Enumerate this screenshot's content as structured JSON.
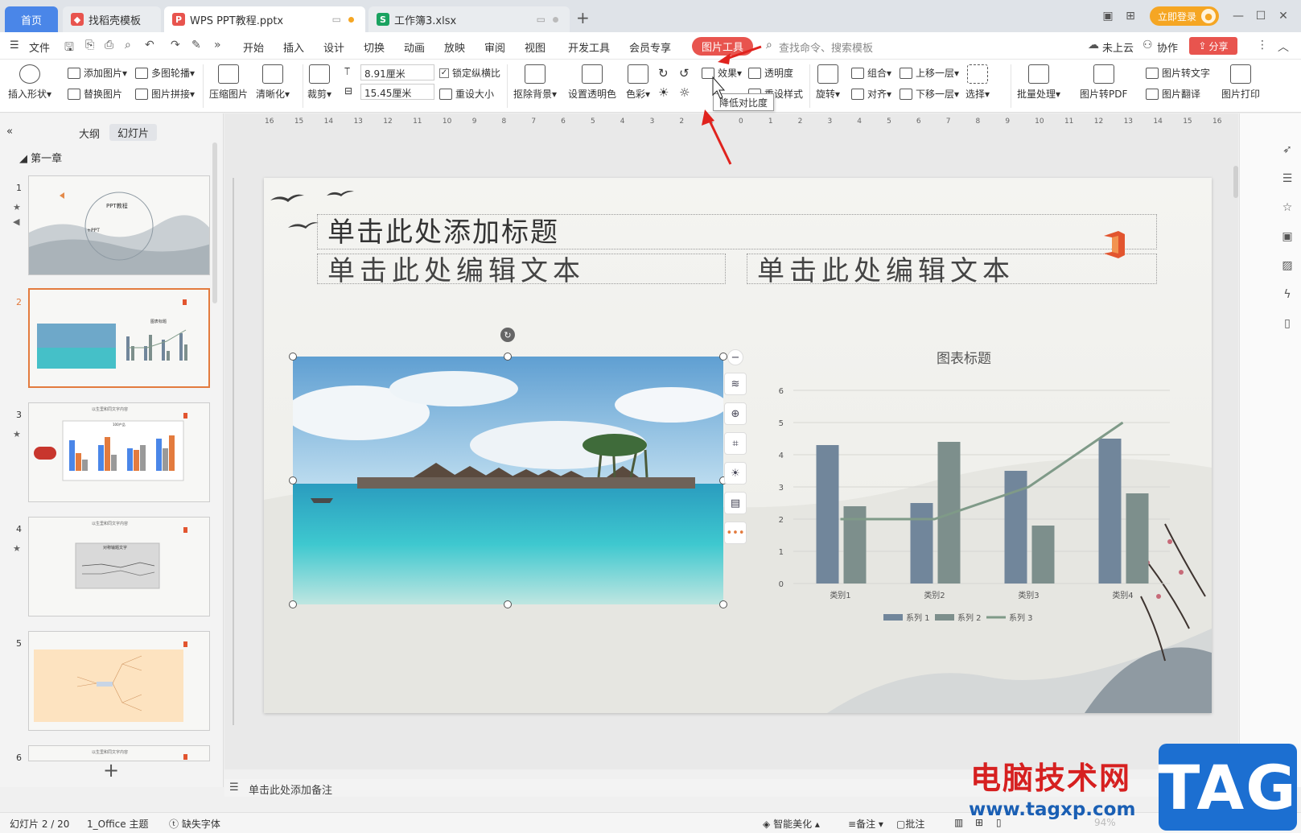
{
  "tabs": {
    "home": "首页",
    "daoke": "找稻壳模板",
    "ppt": "WPS PPT教程.pptx",
    "xls": "工作簿3.xlsx"
  },
  "window": {
    "login": "立即登录"
  },
  "menu": {
    "file": "文件",
    "items": [
      "开始",
      "插入",
      "设计",
      "切换",
      "动画",
      "放映",
      "审阅",
      "视图",
      "开发工具",
      "会员专享"
    ],
    "active": "图片工具",
    "search": "查找命令、搜索模板",
    "cloud": "未上云",
    "collab": "协作",
    "share": "分享"
  },
  "ribbon": {
    "insert_shape": "插入形状",
    "add_image": "添加图片",
    "replace_image": "替换图片",
    "multi_outline": "多图轮播",
    "image_stitch": "图片拼接",
    "compress": "压缩图片",
    "sharpen": "清晰化",
    "crop": "裁剪",
    "width": "8.91厘米",
    "height": "15.45厘米",
    "lock_ratio": "锁定纵横比",
    "reset_size": "重设大小",
    "remove_bg": "抠除背景",
    "set_transparent": "设置透明色",
    "color": "色彩",
    "effects": "效果",
    "transparency": "透明度",
    "reset_style": "重设样式",
    "rotate": "旋转",
    "group": "组合",
    "align": "对齐",
    "bring_forward": "上移一层",
    "send_backward": "下移一层",
    "select": "选择",
    "batch": "批量处理",
    "to_pdf": "图片转PDF",
    "to_text": "图片转文字",
    "translate": "图片翻译",
    "print": "图片打印",
    "tooltip": "降低对比度"
  },
  "left_panel": {
    "tab_outline": "大纲",
    "tab_slides": "幻灯片",
    "chapter": "第一章",
    "slides": [
      "1",
      "2",
      "3",
      "4",
      "5",
      "6"
    ],
    "thumb1_title": "PPT教程",
    "thumb1_sub": "+PPT",
    "thumb2_title": "图表标题",
    "thumb3_heading": "以生里和同文字内容",
    "thumb3_chart": "100产品",
    "thumb4_heading": "以生里和同文字内容",
    "thumb4_chart": "对称输题文字",
    "thumb6_heading": "以生里和同文字内容"
  },
  "slide": {
    "title": "单击此处添加标题",
    "text_left": "单击此处编辑文本",
    "text_right": "单击此处编辑文本"
  },
  "chart_data": {
    "type": "bar",
    "title": "图表标题",
    "categories": [
      "类别1",
      "类别2",
      "类别3",
      "类别4"
    ],
    "series": [
      {
        "name": "系列 1",
        "values": [
          4.3,
          2.5,
          3.5,
          4.5
        ],
        "color": "#71869b"
      },
      {
        "name": "系列 2",
        "values": [
          2.4,
          4.4,
          1.8,
          2.8
        ],
        "color": "#7d8f8c"
      },
      {
        "name": "系列 3",
        "values": [
          2,
          2,
          3,
          5
        ],
        "color": "#7f9a88",
        "kind": "line"
      }
    ],
    "ylim": [
      0,
      6
    ],
    "yticks": [
      "0",
      "1",
      "2",
      "3",
      "4",
      "5",
      "6"
    ],
    "legend": "bottom",
    "grid": true
  },
  "ruler": [
    "16",
    "15",
    "14",
    "13",
    "12",
    "11",
    "10",
    "9",
    "8",
    "7",
    "6",
    "5",
    "4",
    "3",
    "2",
    "1",
    "0",
    "1",
    "2",
    "3",
    "4",
    "5",
    "6",
    "7",
    "8",
    "9",
    "10",
    "11",
    "12",
    "13",
    "14",
    "15",
    "16"
  ],
  "notes": "单击此处添加备注",
  "status": {
    "slide_pos": "幻灯片 2 / 20",
    "theme": "1_Office 主题",
    "missing_font": "缺失字体",
    "smart": "智能美化",
    "notes_btn": "备注",
    "comment": "批注",
    "zoom": "94%"
  },
  "watermark": {
    "site": "电脑技术网",
    "url": "www.tagxp.com",
    "tag": "TAG"
  }
}
